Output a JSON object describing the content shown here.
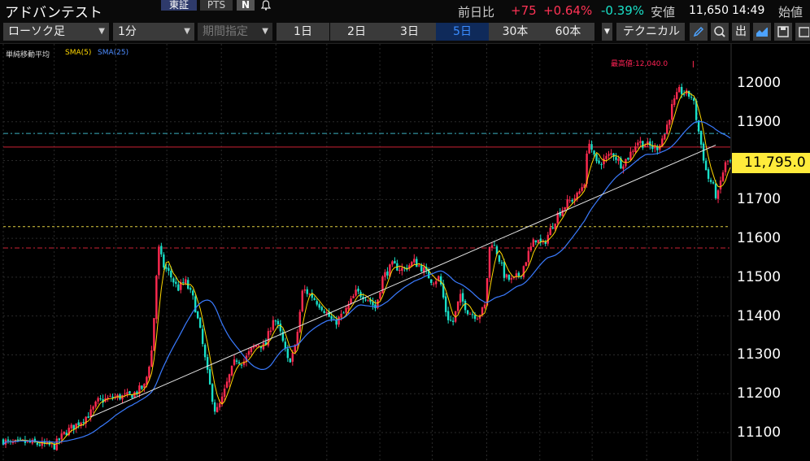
{
  "header": {
    "title": "アドバンテスト",
    "exchanges": [
      "東証",
      "PTS"
    ],
    "n_badge": "N",
    "bell_icon": "bell-icon",
    "change_label": "前日比",
    "change_value": "+75",
    "change_pct": "+0.64%",
    "low_pct": "-0.39%",
    "low_label": "安値",
    "low_value": "11,650",
    "low_time": "14:49",
    "open_label": "始値"
  },
  "toolbar": {
    "chart_type": "ローソク足",
    "interval": "1分",
    "range_select": "期間指定",
    "periods": [
      "1日",
      "2日",
      "3日",
      "5日",
      "30本",
      "60本"
    ],
    "active_period": "5日",
    "technical": "テクニカル",
    "icons": [
      "pen-icon",
      "zoom-icon",
      "export-icon",
      "area-chart-icon",
      "save-icon",
      "window-icon"
    ],
    "export_label": "出"
  },
  "legend": {
    "label": "単純移動平均",
    "sma5": "SMA(5)",
    "sma25": "SMA(25)"
  },
  "colors": {
    "up": "#ff2a50",
    "down": "#19e0c8",
    "sma5": "#ffd700",
    "sma25": "#3a7bff",
    "price_tag": "#ffeb3b",
    "high_line": "#cc2233",
    "cyan_line": "#3ab0c0",
    "yellow_line": "#e0d040"
  },
  "chart_data": {
    "type": "candlestick",
    "ylim": [
      11060,
      12110
    ],
    "yticks": [
      12000,
      11900,
      11800,
      11700,
      11600,
      11500,
      11400,
      11300,
      11200,
      11100
    ],
    "current_price": "11,795.0",
    "high_label": "最高値:12,040.0",
    "high_value": 12040,
    "reference_lines": [
      {
        "value": 11870,
        "style": "cyan-dashdot"
      },
      {
        "value": 11835,
        "style": "red-solid"
      },
      {
        "value": 11630,
        "style": "yellow-dashed"
      },
      {
        "value": 11575,
        "style": "red-dashdot"
      }
    ],
    "trendline": [
      [
        0.12,
        11140
      ],
      [
        0.98,
        11840
      ]
    ],
    "path": [
      [
        0.0,
        11080
      ],
      [
        0.01,
        11070
      ],
      [
        0.03,
        11075
      ],
      [
        0.05,
        11070
      ],
      [
        0.07,
        11065
      ],
      [
        0.085,
        11100
      ],
      [
        0.1,
        11120
      ],
      [
        0.12,
        11150
      ],
      [
        0.13,
        11180
      ],
      [
        0.15,
        11190
      ],
      [
        0.175,
        11195
      ],
      [
        0.195,
        11220
      ],
      [
        0.205,
        11320
      ],
      [
        0.213,
        11580
      ],
      [
        0.22,
        11530
      ],
      [
        0.228,
        11510
      ],
      [
        0.24,
        11470
      ],
      [
        0.25,
        11490
      ],
      [
        0.262,
        11440
      ],
      [
        0.272,
        11350
      ],
      [
        0.282,
        11240
      ],
      [
        0.292,
        11150
      ],
      [
        0.3,
        11180
      ],
      [
        0.31,
        11240
      ],
      [
        0.32,
        11290
      ],
      [
        0.33,
        11280
      ],
      [
        0.34,
        11310
      ],
      [
        0.35,
        11330
      ],
      [
        0.36,
        11320
      ],
      [
        0.372,
        11400
      ],
      [
        0.382,
        11350
      ],
      [
        0.392,
        11280
      ],
      [
        0.402,
        11320
      ],
      [
        0.412,
        11470
      ],
      [
        0.425,
        11450
      ],
      [
        0.44,
        11420
      ],
      [
        0.455,
        11380
      ],
      [
        0.47,
        11410
      ],
      [
        0.485,
        11460
      ],
      [
        0.5,
        11450
      ],
      [
        0.512,
        11420
      ],
      [
        0.522,
        11500
      ],
      [
        0.535,
        11530
      ],
      [
        0.55,
        11520
      ],
      [
        0.565,
        11540
      ],
      [
        0.578,
        11520
      ],
      [
        0.59,
        11490
      ],
      [
        0.6,
        11500
      ],
      [
        0.61,
        11400
      ],
      [
        0.618,
        11380
      ],
      [
        0.628,
        11450
      ],
      [
        0.64,
        11410
      ],
      [
        0.652,
        11400
      ],
      [
        0.662,
        11420
      ],
      [
        0.67,
        11600
      ],
      [
        0.68,
        11560
      ],
      [
        0.69,
        11500
      ],
      [
        0.7,
        11490
      ],
      [
        0.712,
        11510
      ],
      [
        0.722,
        11560
      ],
      [
        0.732,
        11600
      ],
      [
        0.742,
        11580
      ],
      [
        0.752,
        11620
      ],
      [
        0.762,
        11660
      ],
      [
        0.775,
        11690
      ],
      [
        0.79,
        11710
      ],
      [
        0.8,
        11750
      ],
      [
        0.805,
        11860
      ],
      [
        0.815,
        11790
      ],
      [
        0.825,
        11800
      ],
      [
        0.838,
        11820
      ],
      [
        0.85,
        11790
      ],
      [
        0.86,
        11810
      ],
      [
        0.872,
        11850
      ],
      [
        0.885,
        11840
      ],
      [
        0.898,
        11830
      ],
      [
        0.91,
        11870
      ],
      [
        0.92,
        11940
      ],
      [
        0.93,
        11980
      ],
      [
        0.94,
        11970
      ],
      [
        0.948,
        11965
      ],
      [
        0.955,
        11890
      ],
      [
        0.962,
        11820
      ],
      [
        0.968,
        11760
      ],
      [
        0.975,
        11740
      ],
      [
        0.982,
        11700
      ],
      [
        0.988,
        11760
      ],
      [
        0.995,
        11800
      ],
      [
        1.0,
        11795
      ]
    ]
  }
}
